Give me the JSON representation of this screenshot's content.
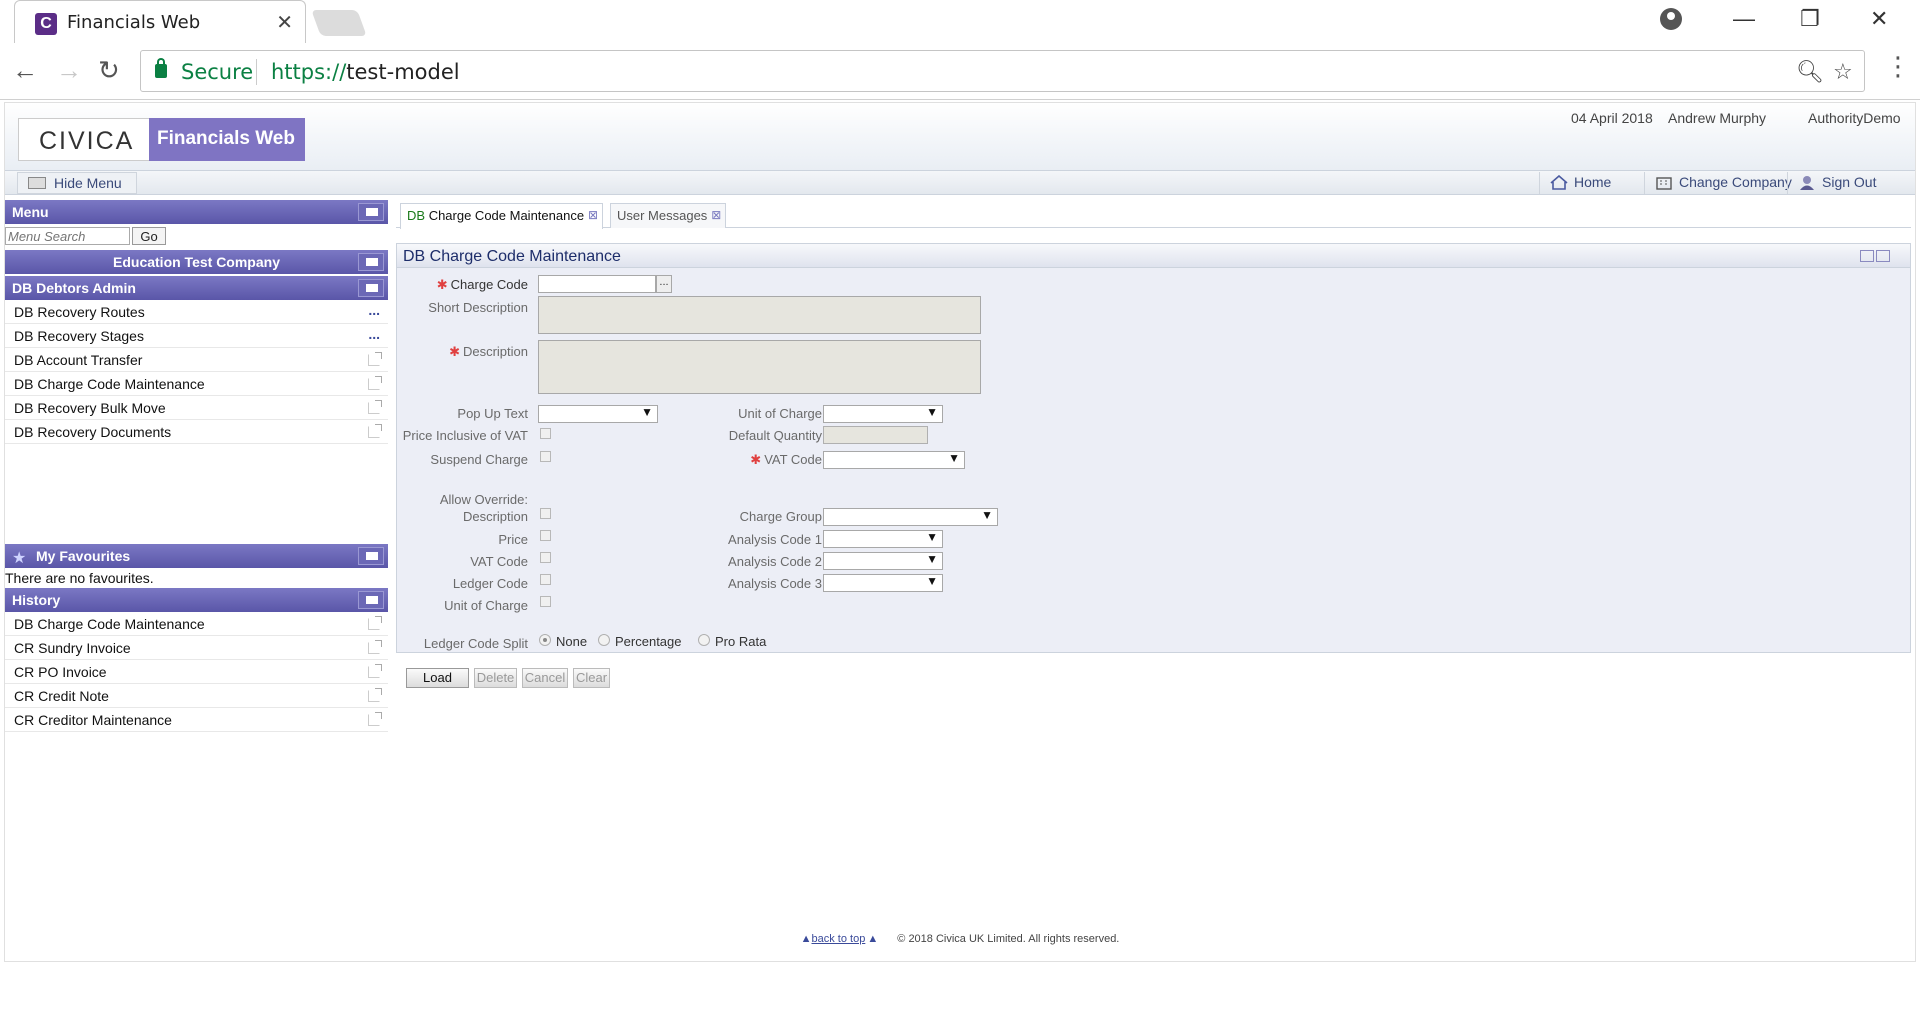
{
  "browser": {
    "tab_title": "Financials Web",
    "tab_favicon_letter": "C",
    "secure_label": "Secure",
    "url_scheme": "https://",
    "url_host": "test-model"
  },
  "app": {
    "logo": "CIVICA",
    "product": "Financials Web",
    "date": "04 April 2018",
    "user": "Andrew Murphy",
    "authority": "AuthorityDemo",
    "hide_menu": "Hide Menu",
    "nav": {
      "home": "Home",
      "change_company": "Change Company",
      "sign_out": "Sign Out"
    }
  },
  "sidebar": {
    "menu_title": "Menu",
    "search_placeholder": "Menu Search",
    "go": "Go",
    "company": "Education Test Company",
    "module": "DB Debtors Admin",
    "items": [
      {
        "label": "DB Recovery Routes"
      },
      {
        "label": "DB Recovery Stages"
      },
      {
        "label": "DB Account Transfer"
      },
      {
        "label": "DB Charge Code Maintenance"
      },
      {
        "label": "DB Recovery Bulk Move"
      },
      {
        "label": "DB Recovery Documents"
      }
    ],
    "favourites_title": "My Favourites",
    "no_favourites": "There are no favourites.",
    "history_title": "History",
    "history": [
      {
        "label": "DB Charge Code Maintenance"
      },
      {
        "label": "CR Sundry Invoice"
      },
      {
        "label": "CR PO Invoice"
      },
      {
        "label": "CR Credit Note"
      },
      {
        "label": "CR Creditor Maintenance"
      }
    ]
  },
  "tabs": {
    "active_prefix": "DB",
    "active_rest": "Charge Code Maintenance",
    "inactive": "User Messages"
  },
  "form": {
    "title": "DB Charge Code Maintenance",
    "charge_code": "Charge Code",
    "short_description": "Short Description",
    "description": "Description",
    "pop_up_text": "Pop Up Text",
    "price_inclusive_vat": "Price Inclusive of VAT",
    "suspend_charge": "Suspend Charge",
    "unit_of_charge": "Unit of Charge",
    "default_quantity": "Default Quantity",
    "vat_code": "VAT Code",
    "allow_override": "Allow Override:",
    "ao_description": "Description",
    "ao_price": "Price",
    "ao_vat_code": "VAT Code",
    "ao_ledger_code": "Ledger Code",
    "ao_unit_of_charge": "Unit of Charge",
    "charge_group": "Charge Group",
    "analysis_code_1": "Analysis Code 1",
    "analysis_code_2": "Analysis Code 2",
    "analysis_code_3": "Analysis Code 3",
    "ledger_code_split": "Ledger Code Split",
    "split_none": "None",
    "split_percentage": "Percentage",
    "split_pro_rata": "Pro Rata",
    "lookup": "..."
  },
  "buttons": {
    "load": "Load",
    "delete": "Delete",
    "cancel": "Cancel",
    "clear": "Clear"
  },
  "footer": {
    "back_to_top": "back to top",
    "copyright": "© 2018 Civica UK Limited. All rights reserved."
  }
}
